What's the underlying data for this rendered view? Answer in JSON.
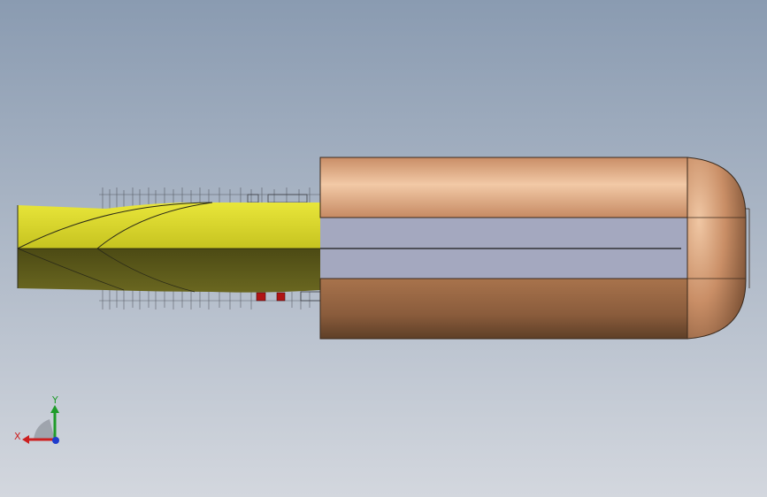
{
  "viewport": {
    "background_top": "#8a9bb1",
    "background_bottom": "#d2d6de"
  },
  "model": {
    "nose_color": "#d8d52b",
    "nose_shadow_color": "#55531c",
    "body_color_light": "#e3b08a",
    "body_color_dark": "#6f4a2d"
  },
  "triad": {
    "x_label": "X",
    "y_label": "Y",
    "x_color": "#cc1f1f",
    "y_color": "#1f9c2a",
    "z_color": "#1f3ccc"
  }
}
